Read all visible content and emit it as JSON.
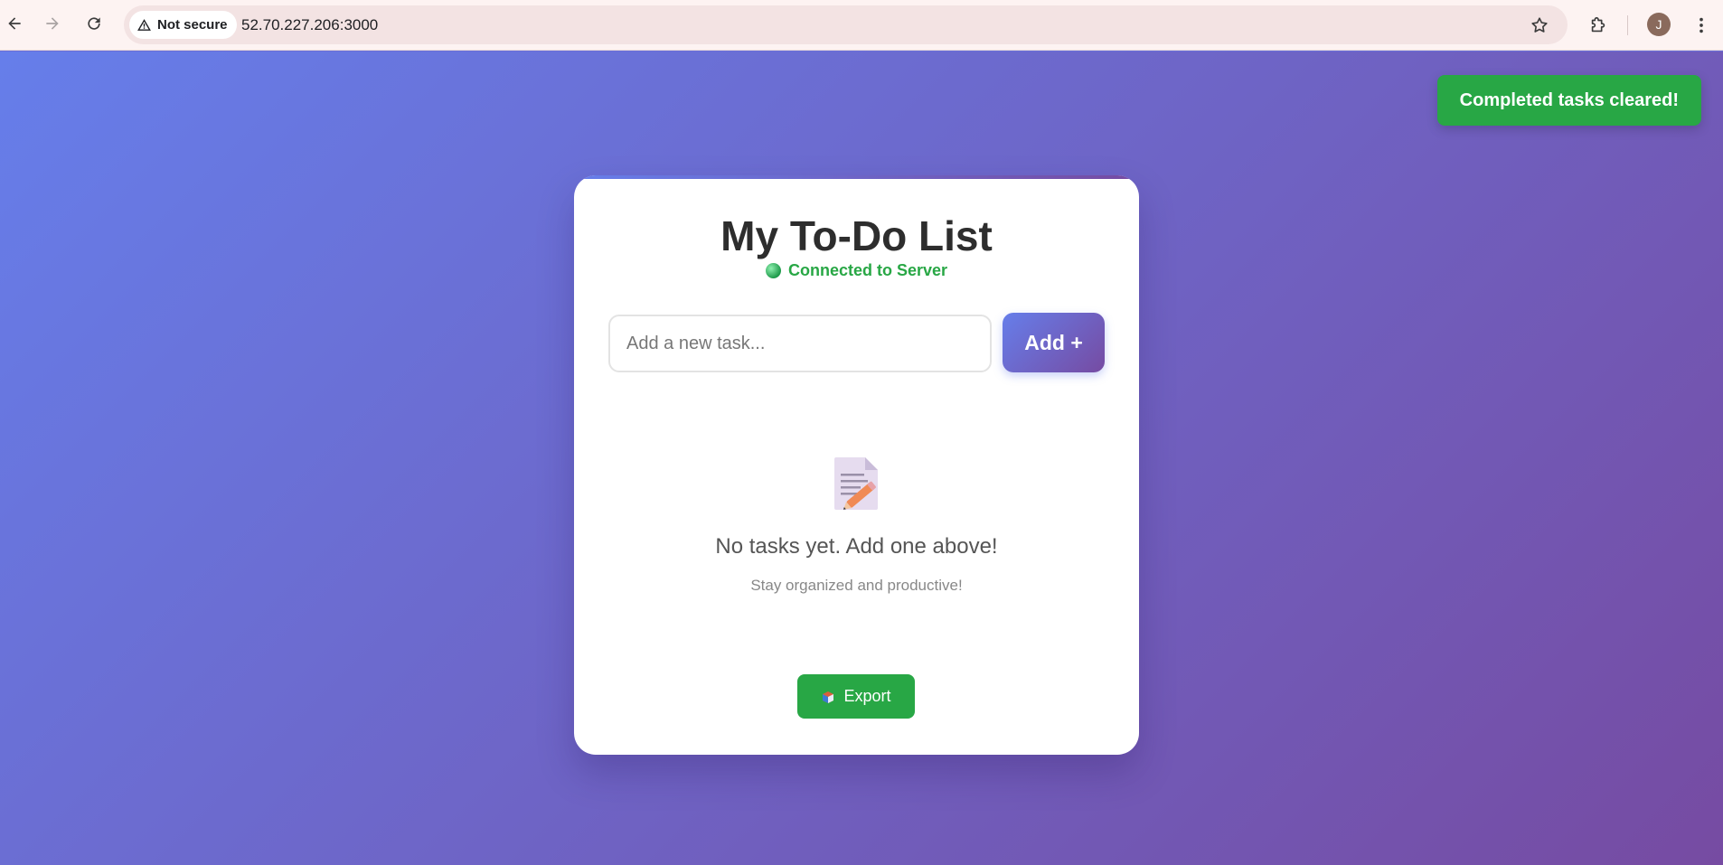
{
  "browser": {
    "security_label": "Not secure",
    "url": "52.70.227.206:3000",
    "profile_initial": "J"
  },
  "toast": {
    "message": "Completed tasks cleared!"
  },
  "app": {
    "title": "My To-Do List",
    "connection_status": "Connected to Server",
    "input_placeholder": "Add a new task...",
    "add_label": "Add +",
    "empty_title": "No tasks yet. Add one above!",
    "empty_subtitle": "Stay organized and productive!",
    "export_label": "Export"
  },
  "icons": {
    "back": "arrow-left-icon",
    "forward": "arrow-right-icon",
    "reload": "reload-icon",
    "warning": "warning-triangle-icon",
    "bookmark": "star-icon",
    "extensions": "puzzle-icon",
    "menu": "kebab-menu-icon",
    "status": "green-dot-icon",
    "empty": "memo-icon",
    "export": "package-icon"
  },
  "colors": {
    "gradient_start": "#667eea",
    "gradient_end": "#764ba2",
    "success": "#28a745",
    "connected_text": "#28a745"
  }
}
